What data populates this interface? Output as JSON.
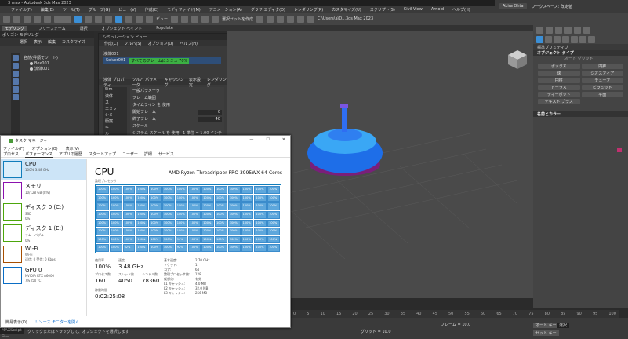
{
  "titlebar": {
    "title": "3 max - Autodesk 3ds Max 2023"
  },
  "menubar": {
    "items": [
      "ファイル(F)",
      "編集(E)",
      "ツール(T)",
      "グループ(G)",
      "ビュー(V)",
      "作成(C)",
      "モディファイヤ(M)",
      "アニメーション(A)",
      "グラフ エディタ(D)",
      "レンダリング(R)",
      "カスタマイズ(U)",
      "スクリプト(S)",
      "Civil View",
      "Arnold",
      "ヘルプ(H)"
    ]
  },
  "topright": {
    "user": "Akira Ohta",
    "search": "ワークスペース: 既定値"
  },
  "toolbar": {
    "view_select": "ビュー",
    "selection_set": "選択セットを作成",
    "path": "C:\\Users\\a\\D...3ds Max 2023"
  },
  "ribbon": {
    "tabs": [
      "モデリング",
      "フリーフォーム",
      "選択",
      "オブジェクト ペイント",
      "Populate"
    ],
    "sub": "ポリゴン モデリング"
  },
  "explorer": {
    "tabs": [
      "選択",
      "表示",
      "編集",
      "カスタマイズ"
    ],
    "header": "名前(昇順でソート)",
    "items": [
      "Box001",
      "流体001"
    ]
  },
  "simview": {
    "title": "シミュレーション ビュー",
    "menu": [
      "作成(C)",
      "ソルバ(S)",
      "オプション(O)",
      "ヘルプ(H)"
    ],
    "group": "液体001",
    "solver": "Solver001",
    "status": "すべてのフレームにシミュ 70%",
    "tabs": [
      "液体 プロパティ",
      "ソルバ パラメータ",
      "キャッシング",
      "表示設定",
      "レンダリング"
    ],
    "left_labels": [
      "Sim",
      "液体",
      "ス",
      "エミッ",
      "シミ",
      "衝突",
      "キ",
      "ル"
    ],
    "props": {
      "header": "一般パラメータ",
      "range": "フレーム範囲",
      "timeline": "タイムライン を 使用",
      "start_label": "開始フレーム",
      "start_value": "0",
      "end_label": "終了フレーム",
      "end_value": "40",
      "scale": "スケール",
      "sys_scale": "システム スケール を 使用",
      "unit": "1 単位 = 1.00 インチ"
    }
  },
  "viewport": {
    "label": "[+][透視投影][ユーザー定義][既定のシェーディング]",
    "mode": "Auto"
  },
  "cmdpanel": {
    "dropdown": "標準プリミティブ",
    "rollout1": "オブジェクト タイプ",
    "autogrid": "オート グリッド",
    "buttons": [
      "ボックス",
      "円錐",
      "球",
      "ジオスフィア",
      "円柱",
      "チューブ",
      "トーラス",
      "ピラミッド",
      "ティーポット",
      "平面",
      "テキスト プラス"
    ],
    "rollout2": "名前とカラー"
  },
  "timeline": {
    "ticks": [
      "0",
      "5",
      "10",
      "15",
      "20",
      "25",
      "30",
      "35",
      "40",
      "45",
      "50",
      "55",
      "60",
      "65",
      "70",
      "75",
      "80",
      "85",
      "90",
      "95",
      "100"
    ]
  },
  "statusbar": {
    "maxscript": "MAXScript ミニ",
    "message": "クリックまたはドラッグして、オブジェクトを選択します",
    "frame": "フレーム = 10.0",
    "autokey": "オート キー",
    "set_key": "セット キー",
    "key_filter": "選択",
    "grid": "グリッド = 10.0"
  },
  "taskman": {
    "title": "タスク マネージャー",
    "menu": [
      "ファイル(F)",
      "オプション(O)",
      "表示(V)"
    ],
    "tabs": [
      "プロセス",
      "パフォーマンス",
      "アプリの履歴",
      "スタートアップ",
      "ユーザー",
      "詳細",
      "サービス"
    ],
    "sidebar": [
      {
        "name": "CPU",
        "sub": "100% 3.48 GHz"
      },
      {
        "name": "メモリ",
        "sub": "10/128 GB (8%)"
      },
      {
        "name": "ディスク 0 (C:)",
        "sub": "SSD",
        "sub2": "0%"
      },
      {
        "name": "ディスク 1 (E:)",
        "sub": "リムーバブル",
        "sub2": "0%"
      },
      {
        "name": "Wi-Fi",
        "sub": "Wi-Fi",
        "sub2": "送信: 0 受信: 0 Kbps"
      },
      {
        "name": "GPU 0",
        "sub": "NVIDIA RTX A6000",
        "sub2": "7% (50 °C)"
      }
    ],
    "cpu_title": "CPU",
    "cpu_model": "AMD Ryzen Threadripper PRO 3995WX 64-Cores",
    "util_label": "論理プロセッサ",
    "cells": [
      "100%",
      "100%",
      "100%",
      "100%",
      "100%",
      "100%",
      "100%",
      "100%",
      "100%",
      "100%",
      "100%",
      "100%",
      "100%",
      "100%",
      "100%",
      "100%",
      "100%",
      "100%",
      "100%",
      "100%",
      "100%",
      "100%",
      "100%",
      "100%",
      "100%",
      "100%",
      "100%",
      "100%",
      "100%",
      "100%",
      "100%",
      "100%",
      "100%",
      "100%",
      "100%",
      "100%",
      "100%",
      "100%",
      "100%",
      "100%",
      "100%",
      "100%",
      "100%",
      "100%",
      "100%",
      "100%",
      "100%",
      "100%",
      "100%",
      "100%",
      "100%",
      "100%",
      "100%",
      "100%",
      "100%",
      "100%",
      "100%",
      "100%",
      "100%",
      "100%",
      "100%",
      "100%",
      "100%",
      "100%",
      "100%",
      "100%",
      "100%",
      "100%",
      "100%",
      "100%",
      "100%",
      "100%",
      "100%",
      "100%",
      "100%",
      "100%",
      "100%",
      "100%",
      "100%",
      "100%",
      "100%",
      "100%",
      "100%",
      "100%",
      "100%",
      "100%",
      "100%",
      "100%",
      "100%",
      "100%",
      "94%",
      "100%",
      "100%",
      "100%",
      "100%",
      "100%",
      "100%",
      "100%",
      "100%",
      "100%",
      "62%",
      "100%",
      "100%",
      "100%",
      "92%",
      "100%",
      "100%",
      "100%",
      "100%",
      "100%",
      "100%",
      "100%",
      "100%",
      "100%",
      "100%",
      "100%",
      "100%",
      "100%",
      "100%",
      "100%",
      "100%",
      "100%",
      "100%",
      "100%",
      "100%",
      "100%"
    ],
    "stats": {
      "util_lbl": "使用率",
      "util": "100%",
      "speed_lbl": "速度",
      "speed": "3.48 GHz",
      "proc_lbl": "プロセス数",
      "proc": "160",
      "threads_lbl": "スレッド数",
      "threads": "4050",
      "handles_lbl": "ハンドル数",
      "handles": "78360",
      "uptime_lbl": "稼働時間",
      "uptime": "0:02:25:08"
    },
    "specs": [
      [
        "基本速度:",
        "2.70 GHz"
      ],
      [
        "ソケット:",
        "1"
      ],
      [
        "コア:",
        "64"
      ],
      [
        "論理プロセッサ数:",
        "128"
      ],
      [
        "仮想化:",
        "有効"
      ],
      [
        "L1 キャッシュ:",
        "4.0 MB"
      ],
      [
        "L2 キャッシュ:",
        "32.0 MB"
      ],
      [
        "L3 キャッシュ:",
        "256 MB"
      ]
    ],
    "fewer": "簡易表示(D)",
    "monitor": "リソース モニターを開く"
  }
}
